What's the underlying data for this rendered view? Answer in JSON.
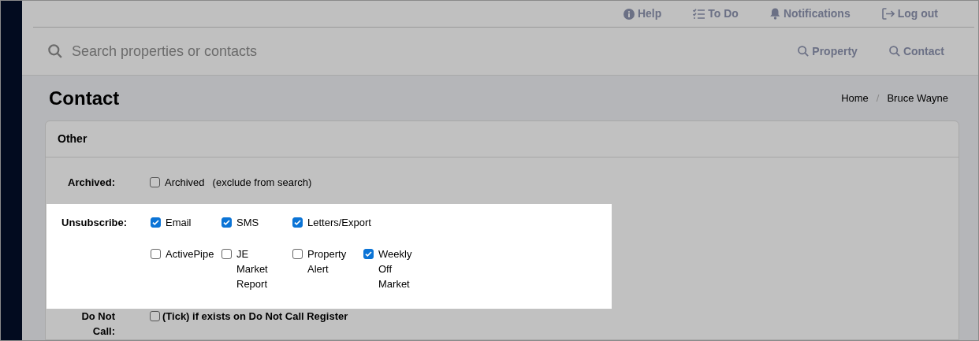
{
  "top_nav": [
    {
      "kind": "help",
      "label": "Help"
    },
    {
      "kind": "todo",
      "label": "To Do"
    },
    {
      "kind": "bell",
      "label": "Notifications"
    },
    {
      "kind": "logout",
      "label": "Log out"
    }
  ],
  "search": {
    "placeholder": "Search properties or contacts"
  },
  "search_buttons": [
    {
      "label": "Property"
    },
    {
      "label": "Contact"
    }
  ],
  "page_title": "Contact",
  "breadcrumb": [
    "Home",
    "Bruce Wayne"
  ],
  "breadcrumb_separator": "/",
  "card": {
    "title": "Other",
    "rows": [
      {
        "kind": "archived",
        "label": "Archived:",
        "highlighted": false,
        "option": {
          "label": "Archived",
          "checked": false
        },
        "note": "(exclude from search)"
      },
      {
        "kind": "options",
        "label": "Unsubscribe:",
        "highlighted": true,
        "lines": [
          [
            {
              "label": "Email",
              "checked": true
            },
            {
              "label": "SMS",
              "checked": true
            },
            {
              "label": "Letters/Export",
              "checked": true
            }
          ],
          [
            {
              "label": "ActivePipe",
              "checked": false
            },
            {
              "label": "JE Market Report",
              "checked": false
            },
            {
              "label": "Property Alert",
              "checked": false
            },
            {
              "label": "Weekly Off Market",
              "checked": true
            }
          ]
        ]
      },
      {
        "kind": "single",
        "label": "Do Not Call:",
        "highlighted": false,
        "option": {
          "label": "(Tick) if exists on Do Not Call Register",
          "checked": false
        }
      }
    ]
  }
}
